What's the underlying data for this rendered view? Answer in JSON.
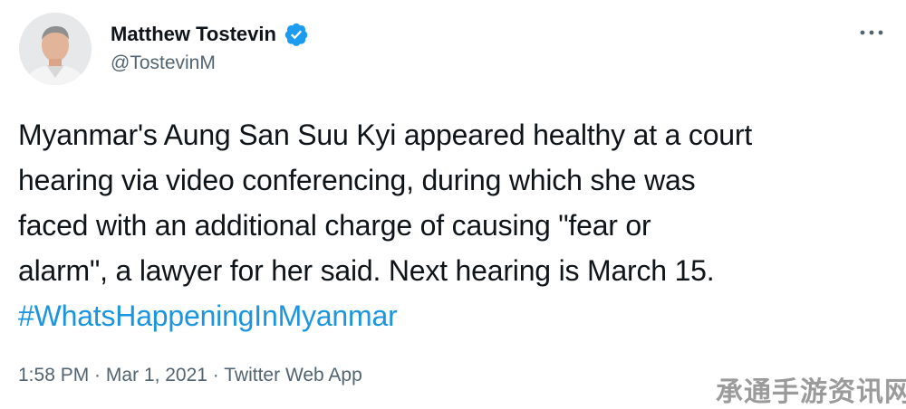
{
  "author": {
    "display_name": "Matthew Tostevin",
    "handle": "@TostevinM",
    "verified": true,
    "avatar_icon": "profile-photo"
  },
  "menu": {
    "icon": "more-icon"
  },
  "tweet": {
    "lines": [
      "Myanmar's Aung San Suu Kyi appeared healthy at a court",
      "hearing via video conferencing, during which she was",
      "faced with an additional charge of causing \"fear or",
      "alarm\", a lawyer for her said. Next hearing is March 15."
    ],
    "hashtag": "#WhatsHappeningInMyanmar"
  },
  "meta": {
    "time": "1:58 PM",
    "separator": " · ",
    "date": "Mar 1, 2021",
    "source": "Twitter Web App"
  },
  "watermark": {
    "text": "承通手游资讯网"
  },
  "colors": {
    "text": "#0f1419",
    "secondary": "#536471",
    "link": "#1b95e0",
    "verified": "#1d9bf0"
  }
}
